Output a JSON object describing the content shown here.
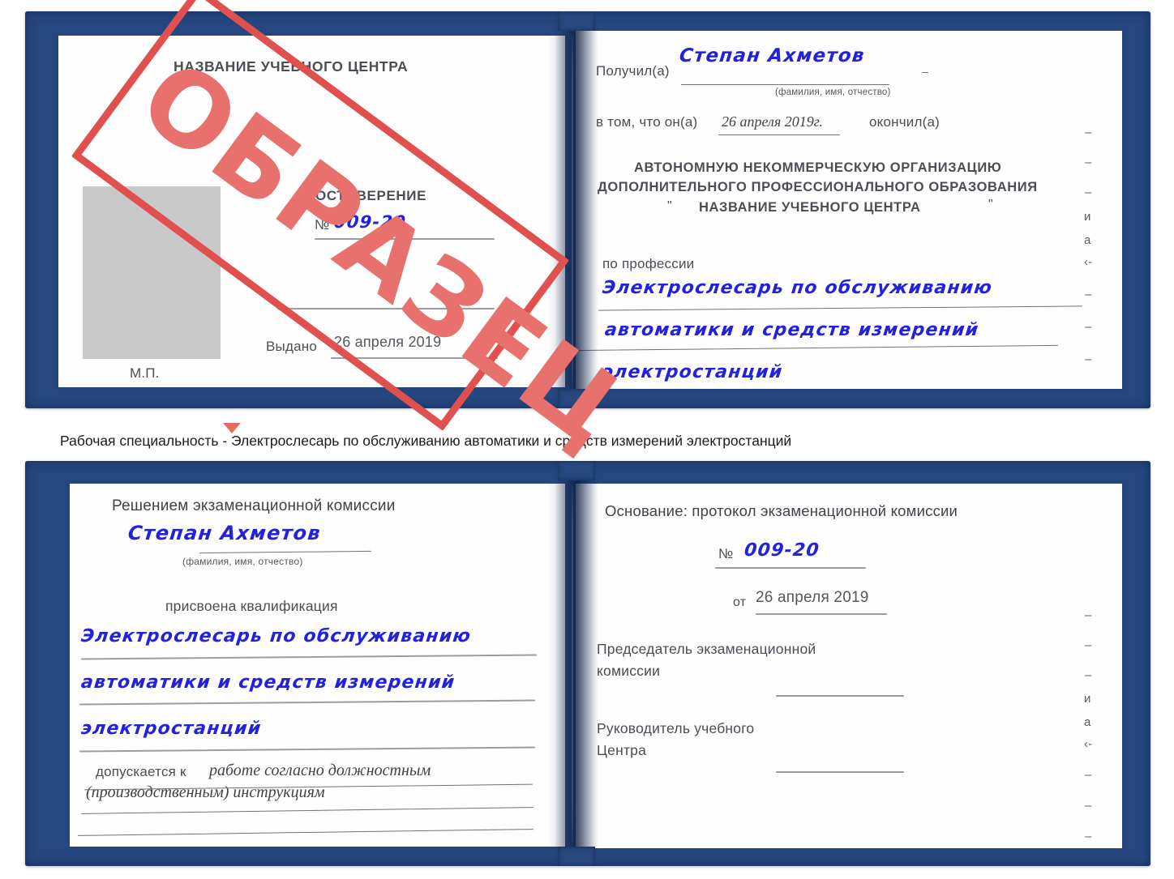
{
  "document": {
    "type": "certificate-sample",
    "watermark": {
      "text": "ОБРАЗЕЦ",
      "color": "#e0504e"
    },
    "cover_color": "#2a4d8f",
    "ink_color": "#2222dd"
  },
  "caption": {
    "text": "Рабочая специальность - Электрослесарь по обслуживанию автоматики и средств измерений электростанций"
  },
  "book_top": {
    "left_page": {
      "title": "НАЗВАНИЕ УЧЕБНОГО ЦЕНТРА",
      "doc_kind": "УДОСТОВЕРЕНИЕ",
      "number_label": "№",
      "number_value": "009-20",
      "issued_label": "Выдано",
      "issued_value": "26 апреля 2019",
      "seal_label": "М.П."
    },
    "right_page": {
      "received_label": "Получил(а)",
      "received_value": "Степан Ахметов",
      "received_hint": "(фамилия, имя, отчество)",
      "in_that_label": "в том, что он(а)",
      "in_that_value": "26 апреля 2019г.",
      "finished_label": "окончил(а)",
      "org_line1": "АВТОНОМНУЮ НЕКОММЕРЧЕСКУЮ ОРГАНИЗАЦИЮ",
      "org_line2": "ДОПОЛНИТЕЛЬНОГО ПРОФЕССИОНАЛЬНОГО ОБРАЗОВАНИЯ",
      "org_quote_open": "\"",
      "org_line3": "НАЗВАНИЕ УЧЕБНОГО ЦЕНТРА",
      "org_quote_close": "\"",
      "profession_label": "по профессии",
      "profession_line1": "Электрослесарь по обслуживанию",
      "profession_line2": "автоматики и средств измерений",
      "profession_line3": "электростанций",
      "edge_bleed": [
        "–",
        "–",
        "–",
        "и",
        "а",
        "‹-",
        "–",
        "–",
        "–"
      ]
    }
  },
  "book_bottom": {
    "left_page": {
      "heading": "Решением экзаменационной комиссии",
      "name_value": "Степан Ахметов",
      "name_hint": "(фамилия, имя, отчество)",
      "qualification_label": "присвоена квалификация",
      "qualification_line1": "Электрослесарь по обслуживанию",
      "qualification_line2": "автоматики и средств измерений",
      "qualification_line3": "электростанций",
      "admitted_label": "допускается к",
      "admitted_line1": "работе согласно должностным",
      "admitted_line2": "(производственным) инструкциям"
    },
    "right_page": {
      "basis_label": "Основание: протокол экзаменационной комиссии",
      "protocol_number_label": "№",
      "protocol_number_value": "009-20",
      "protocol_date_label": "от",
      "protocol_date_value": "26 апреля 2019",
      "chairman_line1": "Председатель экзаменационной",
      "chairman_line2": "комиссии",
      "head_line1": "Руководитель учебного",
      "head_line2": "Центра",
      "edge_bleed": [
        "–",
        "–",
        "–",
        "и",
        "а",
        "‹-",
        "–",
        "–",
        "–"
      ]
    }
  }
}
